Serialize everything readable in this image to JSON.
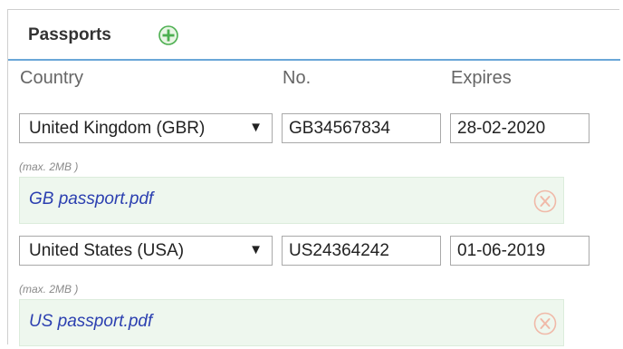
{
  "panel": {
    "title": "Passports",
    "add_icon": "plus-circle-icon",
    "accent_color": "#6aa7d8",
    "add_color": "#4caf50"
  },
  "columns": [
    "Country",
    "No.",
    "Expires"
  ],
  "entries": [
    {
      "country": "United Kingdom (GBR)",
      "number": "GB34567834",
      "expires": "28-02-2020",
      "hint": "(max. 2MB )",
      "file": "GB passport.pdf",
      "remove_icon": "remove-x-icon"
    },
    {
      "country": "United States (USA)",
      "number": "US24364242",
      "expires": "01-06-2019",
      "hint": "(max. 2MB )",
      "file": "US passport.pdf",
      "remove_icon": "remove-x-icon"
    }
  ]
}
